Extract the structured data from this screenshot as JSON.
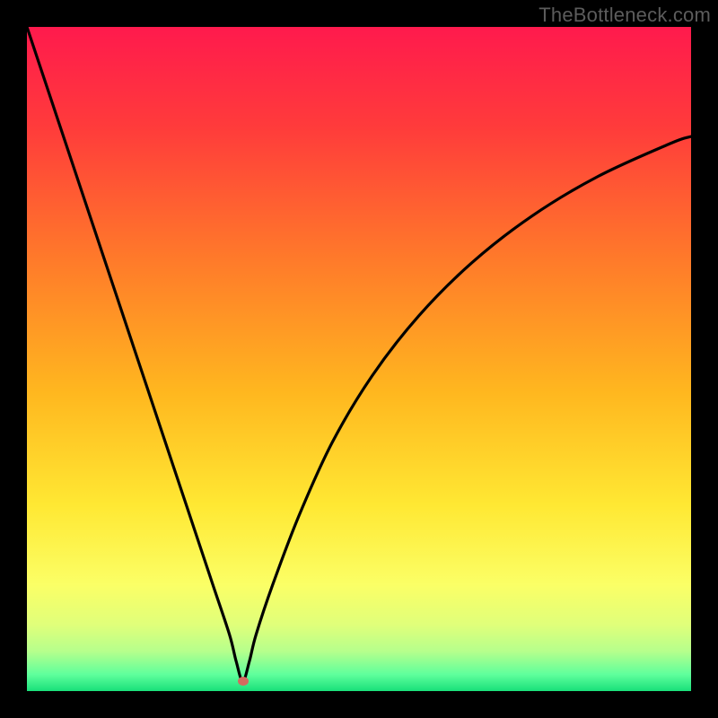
{
  "watermark": "TheBottleneck.com",
  "plot": {
    "inner_width": 740,
    "inner_height": 740,
    "margin": 30
  },
  "dot": {
    "x_frac": 0.325,
    "y_frac": 0.985
  },
  "chart_data": {
    "type": "line",
    "title": "",
    "xlabel": "",
    "ylabel": "",
    "xlim": [
      0,
      1
    ],
    "ylim": [
      0,
      1
    ],
    "note": "x-fraction increases left→right; y-fraction increases top→bottom (0 = top of plot). Curve traces a V-shaped bottleneck profile. Values estimated from pixels.",
    "series": [
      {
        "name": "bottleneck-curve",
        "x": [
          0.0,
          0.04,
          0.08,
          0.12,
          0.16,
          0.2,
          0.24,
          0.28,
          0.305,
          0.315,
          0.325,
          0.335,
          0.345,
          0.37,
          0.41,
          0.46,
          0.52,
          0.59,
          0.67,
          0.76,
          0.86,
          0.97,
          1.0
        ],
        "y": [
          0.0,
          0.12,
          0.24,
          0.36,
          0.48,
          0.6,
          0.72,
          0.84,
          0.915,
          0.955,
          0.985,
          0.955,
          0.915,
          0.84,
          0.735,
          0.625,
          0.525,
          0.435,
          0.355,
          0.285,
          0.225,
          0.175,
          0.165
        ]
      }
    ],
    "background_gradient": {
      "stops": [
        {
          "offset": 0.0,
          "color": "#ff1a4d"
        },
        {
          "offset": 0.15,
          "color": "#ff3b3b"
        },
        {
          "offset": 0.35,
          "color": "#ff7a2a"
        },
        {
          "offset": 0.55,
          "color": "#ffb71f"
        },
        {
          "offset": 0.72,
          "color": "#ffe833"
        },
        {
          "offset": 0.84,
          "color": "#fbff66"
        },
        {
          "offset": 0.9,
          "color": "#e0ff7a"
        },
        {
          "offset": 0.94,
          "color": "#b6ff8c"
        },
        {
          "offset": 0.975,
          "color": "#5fff9c"
        },
        {
          "offset": 1.0,
          "color": "#19e07a"
        }
      ]
    },
    "marker": {
      "x": 0.325,
      "y": 0.985,
      "color": "#d46a5f"
    }
  }
}
